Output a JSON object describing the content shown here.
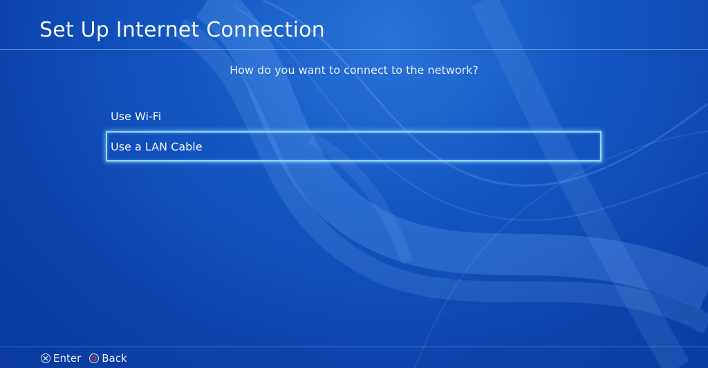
{
  "header": {
    "title": "Set Up Internet Connection"
  },
  "prompt": {
    "question": "How do you want to connect to the network?"
  },
  "options": [
    {
      "label": "Use Wi-Fi",
      "selected": false
    },
    {
      "label": "Use a LAN Cable",
      "selected": true
    }
  ],
  "footer": {
    "enter": {
      "icon": "cross-button-icon",
      "label": "Enter"
    },
    "back": {
      "icon": "circle-button-icon",
      "label": "Back"
    }
  },
  "colors": {
    "background": "#1458c4",
    "selection_border": "#9fd6ff",
    "circle_button": "#e5363b"
  }
}
